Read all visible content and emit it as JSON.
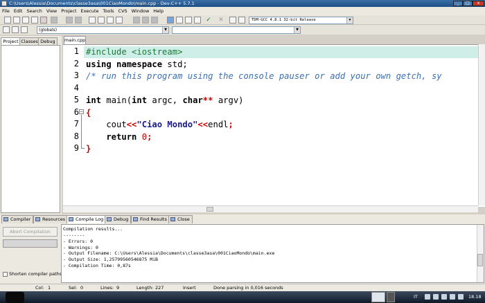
{
  "window": {
    "title": "C:\\Users\\Alessia\\Documents\\classe3asa\\001CiaoMondo\\main.cpp - Dev-C++ 5.7.1"
  },
  "menu": [
    "File",
    "Edit",
    "Search",
    "View",
    "Project",
    "Execute",
    "Tools",
    "CVS",
    "Window",
    "Help"
  ],
  "toolbar": {
    "compiler": "TDM-GCC 4.8.1 32-bit Release",
    "scope": "(globals)"
  },
  "left_tabs": [
    "Project",
    "Classes",
    "Debug"
  ],
  "editor": {
    "file_tab": "main.cpp",
    "line_numbers": [
      "1",
      "2",
      "3",
      "4",
      "5",
      "6",
      "7",
      "8",
      "9"
    ],
    "code": {
      "l1": "#include <iostream>",
      "l2_kw": "using namespace",
      "l2_rest": " std;",
      "l3": "/* run this program using the console pauser or add your own getch, sy",
      "l5_a": "int",
      "l5_b": " main(",
      "l5_c": "int",
      "l5_d": " argc, ",
      "l5_e": "char",
      "l5_f": "**",
      "l5_g": " argv)",
      "l6": "{",
      "l7_a": "    cout",
      "l7_b": "<<",
      "l7_c": "\"Ciao Mondo\"",
      "l7_d": "<<",
      "l7_e": "endl",
      "l7_f": ";",
      "l8_a": "    return",
      "l8_b": " 0",
      "l8_c": ";",
      "l9": "}"
    }
  },
  "bottom_tabs": [
    "Compiler",
    "Resources",
    "Compile Log",
    "Debug",
    "Find Results",
    "Close"
  ],
  "compile_panel": {
    "abort_label": "Abort Compilation",
    "shorten_label": "Shorten compiler paths",
    "log": [
      "Compilation results...",
      "--------",
      "- Errors: 0",
      "- Warnings: 0",
      "- Output Filename: C:\\Users\\Alessia\\Documents\\classe3asa\\001CiaoMondo\\main.exe",
      "- Output Size: 1,25799560546875 MiB",
      "- Compilation Time: 0,87s"
    ]
  },
  "status": {
    "col_label": "Col:",
    "col": "1",
    "sel_label": "Sel:",
    "sel": "0",
    "lines_label": "Lines:",
    "lines": "9",
    "length_label": "Length:",
    "length": "227",
    "mode": "Insert",
    "message": "Done parsing in 0,016 seconds"
  },
  "taskbar": {
    "lang": "IT",
    "clock": "18.18"
  }
}
